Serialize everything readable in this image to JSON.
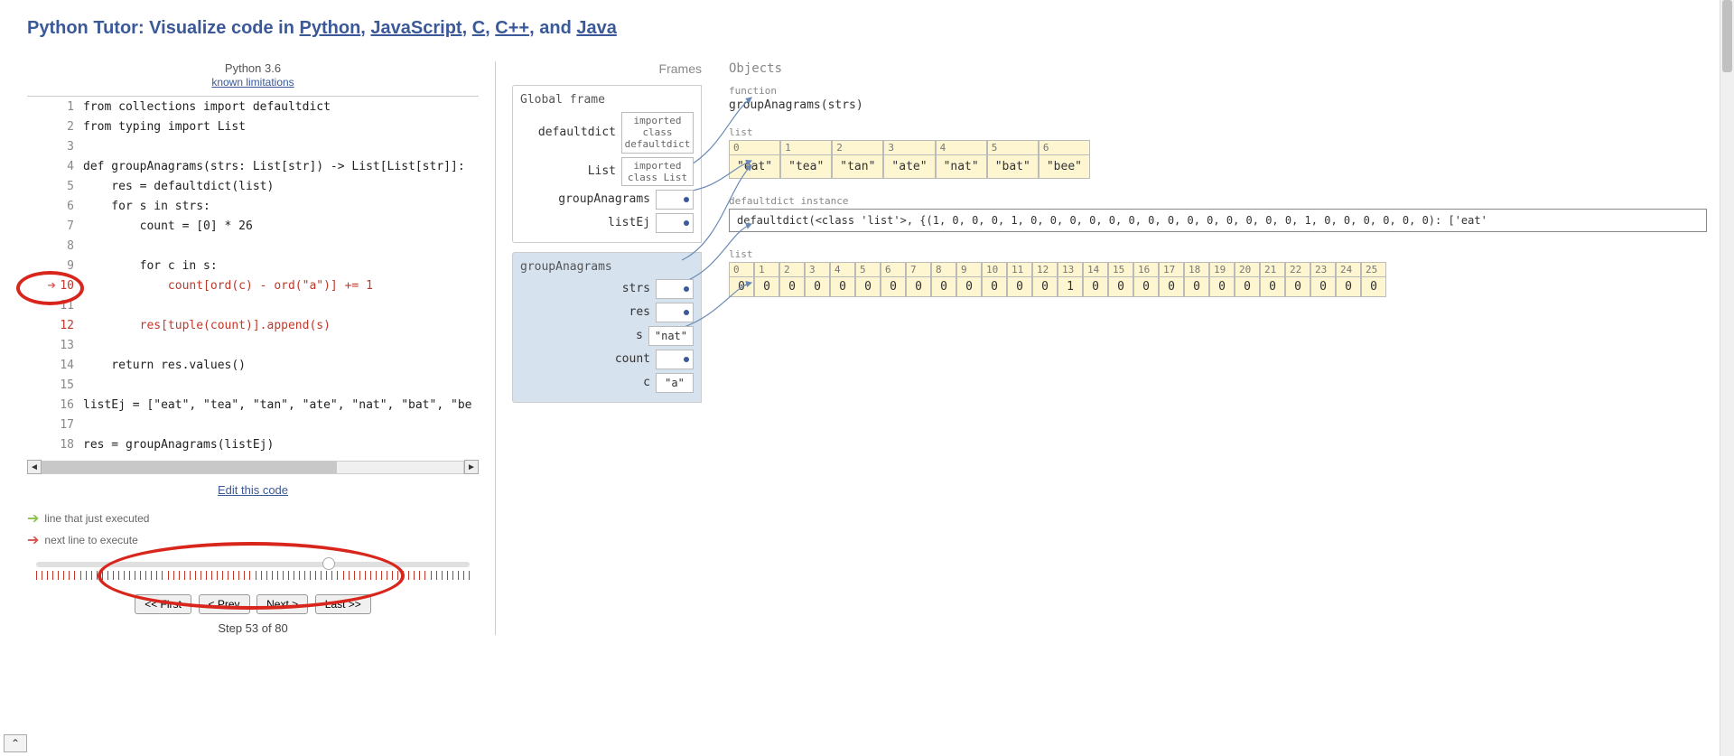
{
  "title": {
    "prefix": "Python Tutor: Visualize code in ",
    "links": [
      "Python",
      "JavaScript",
      "C",
      "C++",
      "Java"
    ],
    "joiner": ", ",
    "last_joiner": ", and "
  },
  "subtitle": {
    "lang": "Python 3.6",
    "limitations": "known limitations"
  },
  "code": [
    {
      "n": 1,
      "text": "from collections import defaultdict"
    },
    {
      "n": 2,
      "text": "from typing import List"
    },
    {
      "n": 3,
      "text": ""
    },
    {
      "n": 4,
      "text": "def groupAnagrams(strs: List[str]) -> List[List[str]]:"
    },
    {
      "n": 5,
      "text": "    res = defaultdict(list)"
    },
    {
      "n": 6,
      "text": "    for s in strs:"
    },
    {
      "n": 7,
      "text": "        count = [0] * 26"
    },
    {
      "n": 8,
      "text": ""
    },
    {
      "n": 9,
      "text": "        for c in s:"
    },
    {
      "n": 10,
      "text": "            count[ord(c) - ord(\"a\")] += 1",
      "hl": "next"
    },
    {
      "n": 11,
      "text": ""
    },
    {
      "n": 12,
      "text": "        res[tuple(count)].append(s)",
      "hl": "red"
    },
    {
      "n": 13,
      "text": ""
    },
    {
      "n": 14,
      "text": "    return res.values()"
    },
    {
      "n": 15,
      "text": ""
    },
    {
      "n": 16,
      "text": "listEj = [\"eat\", \"tea\", \"tan\", \"ate\", \"nat\", \"bat\", \"be"
    },
    {
      "n": 17,
      "text": ""
    },
    {
      "n": 18,
      "text": "res = groupAnagrams(listEj)"
    }
  ],
  "edit_link": "Edit this code",
  "legend": {
    "executed": "line that just executed",
    "next": "next line to execute"
  },
  "nav": {
    "first": "<< First",
    "prev": "< Prev",
    "next": "Next >",
    "last": "Last >>"
  },
  "step": {
    "cur": 53,
    "total": 80,
    "label_prefix": "Step ",
    "label_mid": " of "
  },
  "headers": {
    "frames": "Frames",
    "objects": "Objects"
  },
  "global_frame": {
    "title": "Global frame",
    "vars": [
      {
        "name": "defaultdict",
        "kind": "text",
        "value": "imported class defaultdict"
      },
      {
        "name": "List",
        "kind": "text",
        "value": "imported class List"
      },
      {
        "name": "groupAnagrams",
        "kind": "ptr"
      },
      {
        "name": "listEj",
        "kind": "ptr"
      }
    ]
  },
  "call_frame": {
    "title": "groupAnagrams",
    "vars": [
      {
        "name": "strs",
        "kind": "ptr"
      },
      {
        "name": "res",
        "kind": "ptr"
      },
      {
        "name": "s",
        "kind": "val",
        "value": "\"nat\""
      },
      {
        "name": "count",
        "kind": "ptr"
      },
      {
        "name": "c",
        "kind": "val",
        "value": "\"a\""
      }
    ]
  },
  "objects": {
    "func": {
      "label": "function",
      "sig": "groupAnagrams(strs)"
    },
    "list1": {
      "label": "list",
      "items": [
        "\"eat\"",
        "\"tea\"",
        "\"tan\"",
        "\"ate\"",
        "\"nat\"",
        "\"bat\"",
        "\"bee\""
      ]
    },
    "dd": {
      "label": "defaultdict instance",
      "repr": "defaultdict(<class 'list'>, {(1, 0, 0, 0, 1, 0, 0, 0, 0, 0, 0, 0, 0, 0, 0, 0, 0, 0, 0, 1, 0, 0, 0, 0, 0, 0): ['eat'"
    },
    "list2": {
      "label": "list",
      "items": [
        0,
        0,
        0,
        0,
        0,
        0,
        0,
        0,
        0,
        0,
        0,
        0,
        0,
        1,
        0,
        0,
        0,
        0,
        0,
        0,
        0,
        0,
        0,
        0,
        0,
        0
      ]
    }
  }
}
